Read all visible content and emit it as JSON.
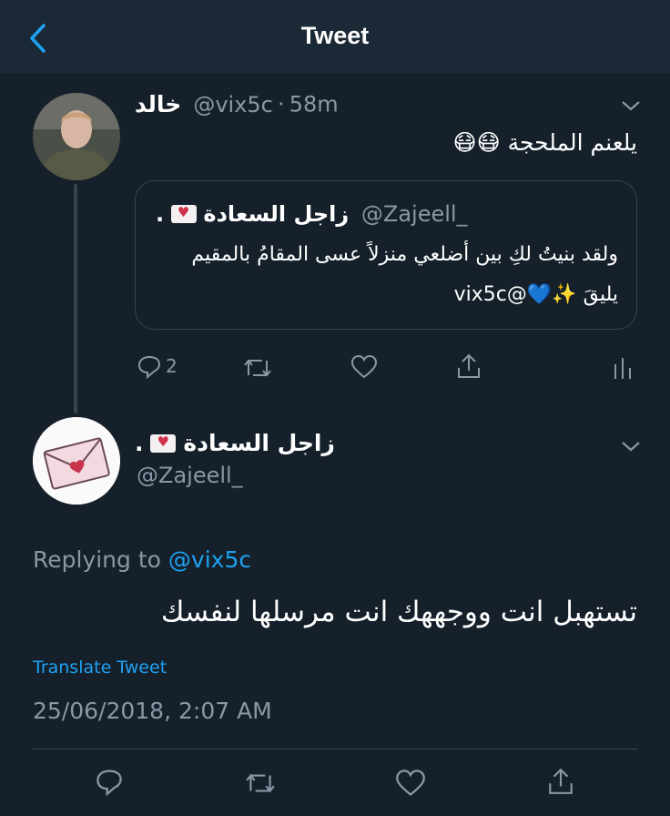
{
  "header": {
    "title": "Tweet"
  },
  "tweet1": {
    "name": "خالد",
    "handle": "@vix5c",
    "sep": "·",
    "time": "58m",
    "text": "يلعنم الملحجة 😷😷",
    "quote": {
      "name": "زاجل السعادة",
      "suffix": ".",
      "handle": "@Zajeell_",
      "line1": "ولقد بنيتُ لكِ بين أضلعي منزلاً عسى المقامُ بالمقيم",
      "line2": "يليقَ ✨💙@vix5c"
    },
    "actions": {
      "reply_count": "2"
    }
  },
  "tweet2": {
    "name": "زاجل السعادة",
    "suffix": ".",
    "handle": "@Zajeell_",
    "replying_label": "Replying to",
    "replying_to": "@vix5c",
    "text": "تستهبل انت ووجههك انت مرسلها لنفسك",
    "translate": "Translate Tweet",
    "timestamp": "25/06/2018, 2:07 AM"
  },
  "colors": {
    "background": "#15202b",
    "accent": "#1da1f2",
    "muted": "#8899a6",
    "border": "#38444d"
  }
}
